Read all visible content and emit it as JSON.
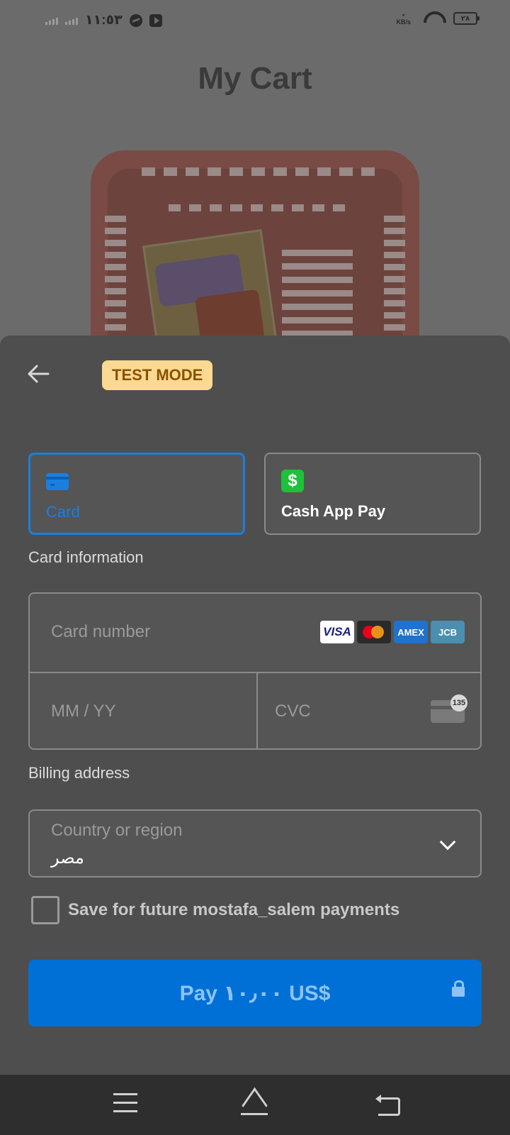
{
  "status_bar": {
    "time": "١١:٥٣",
    "speed": "KB/s",
    "battery": "٢٨"
  },
  "page": {
    "title": "My Cart"
  },
  "sheet": {
    "badge": "TEST MODE",
    "payment_methods": [
      {
        "label": "Card",
        "icon": "credit-card-icon",
        "selected": true,
        "accent": "#1a7fe0"
      },
      {
        "label": "Cash App Pay",
        "icon": "cash-app-icon",
        "selected": false,
        "accent": "#1fc13a"
      }
    ],
    "cash_glyph": "$",
    "card_section_label": "Card information",
    "card_number_placeholder": "Card number",
    "card_brands": [
      "VISA",
      "MC",
      "AMEX",
      "JCB"
    ],
    "expiry_placeholder": "MM / YY",
    "cvc_placeholder": "CVC",
    "cvc_badge": "135",
    "billing_label": "Billing address",
    "country_label": "Country or region",
    "country_value": "مصر",
    "save_text": "Save for future mostafa_salem payments",
    "pay_label": "Pay ١٠٫٠٠ US$",
    "pay_color": "#0070d6"
  }
}
